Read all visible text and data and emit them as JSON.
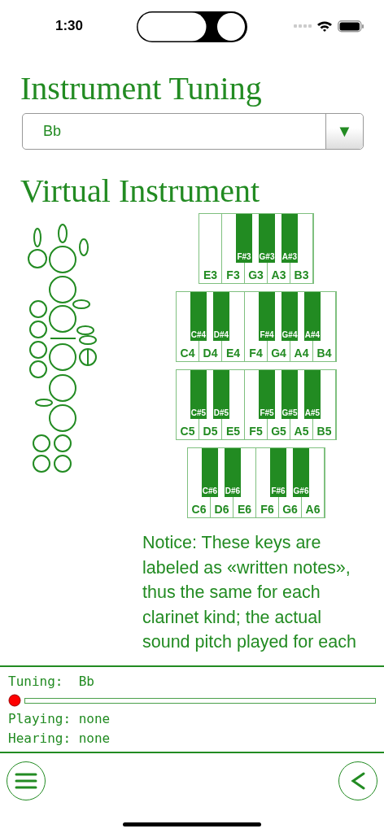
{
  "status_bar": {
    "time": "1:30"
  },
  "tuning": {
    "heading": "Instrument Tuning",
    "value": "Bb",
    "arrow": "▼"
  },
  "instrument": {
    "heading": "Virtual Instrument",
    "keyboards": [
      {
        "keys": [
          {
            "label": "E3"
          },
          {
            "label": "F3",
            "sharp": "F#3"
          },
          {
            "label": "G3",
            "sharp": "G#3"
          },
          {
            "label": "A3",
            "sharp": "A#3"
          },
          {
            "label": "B3"
          }
        ]
      },
      {
        "keys": [
          {
            "label": "C4",
            "sharp": "C#4"
          },
          {
            "label": "D4",
            "sharp": "D#4"
          },
          {
            "label": "E4"
          },
          {
            "label": "F4",
            "sharp": "F#4"
          },
          {
            "label": "G4",
            "sharp": "G#4"
          },
          {
            "label": "A4",
            "sharp": "A#4"
          },
          {
            "label": "B4"
          }
        ]
      },
      {
        "keys": [
          {
            "label": "C5",
            "sharp": "C#5"
          },
          {
            "label": "D5",
            "sharp": "D#5"
          },
          {
            "label": "E5"
          },
          {
            "label": "F5",
            "sharp": "F#5"
          },
          {
            "label": "G5",
            "sharp": "G#5"
          },
          {
            "label": "A5",
            "sharp": "A#5"
          },
          {
            "label": "B5"
          }
        ]
      },
      {
        "keys": [
          {
            "label": "C6",
            "sharp": "C#6"
          },
          {
            "label": "D6",
            "sharp": "D#6"
          },
          {
            "label": "E6"
          },
          {
            "label": "F6",
            "sharp": "F#6"
          },
          {
            "label": "G6",
            "sharp": "G#6"
          },
          {
            "label": "A6"
          }
        ]
      }
    ],
    "notice": "Notice: These keys are labeled as «written notes», thus the same for each clarinet kind; the actual sound pitch played for each"
  },
  "monitor": {
    "tuning_label": "Tuning:",
    "tuning_value": "Bb",
    "playing_label": "Playing:",
    "playing_value": "none",
    "hearing_label": "Hearing:",
    "hearing_value": "none"
  }
}
